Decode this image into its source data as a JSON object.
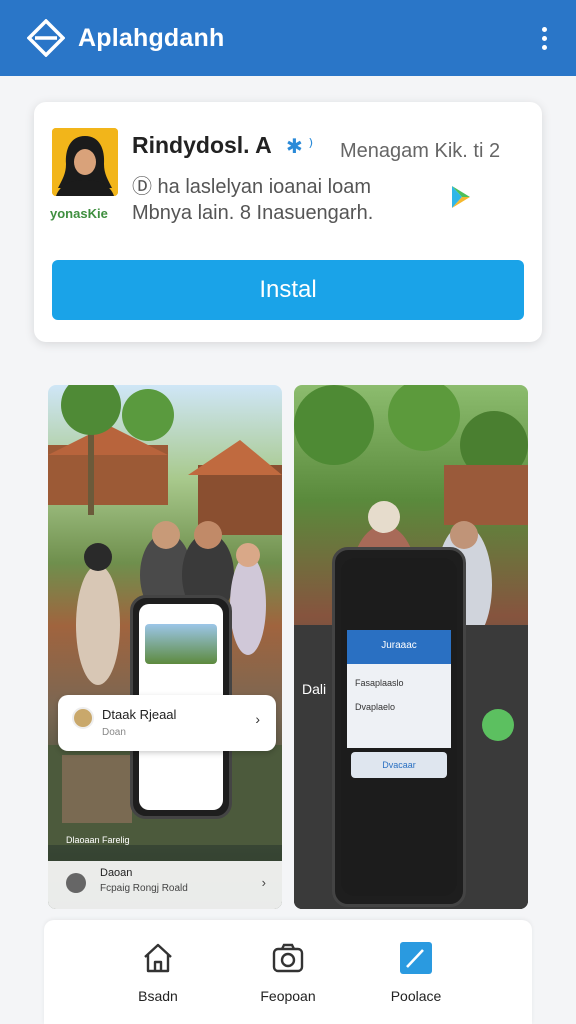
{
  "app": {
    "title": "Aplahgdanh"
  },
  "colors": {
    "primary": "#2a76c8",
    "install": "#1aa3e8"
  },
  "listing": {
    "name": "Rindydosl. A",
    "meta_right": "Menagam Kik. ti 2",
    "line2": "Ⓓ ha laslelyan ioanai loam",
    "line3": "Mbnya lain. 8 Inasuengarh.",
    "avatar_label": "yonasKie",
    "install_label": "Instal",
    "icons": {
      "verified": "verified-badge-icon",
      "play": "play-store-icon"
    }
  },
  "screenshots": {
    "left": {
      "popup_title": "Dtaak Rjeaal",
      "popup_sub": "Doan",
      "footer_title": "Daoan",
      "footer_sub": "Fcpaig Rongj Roald",
      "caption": "Dlaoaan Farelig"
    },
    "right": {
      "header": "Juraaac",
      "row1": "Fasaplaaslo",
      "row2": "Dvaplaelo",
      "button": "Dvacaar",
      "caption": "Dali"
    }
  },
  "tabs": [
    {
      "label": "Bsadn",
      "icon": "home-icon"
    },
    {
      "label": "Feopoan",
      "icon": "camera-icon"
    },
    {
      "label": "Poolace",
      "icon": "edit-icon"
    }
  ]
}
